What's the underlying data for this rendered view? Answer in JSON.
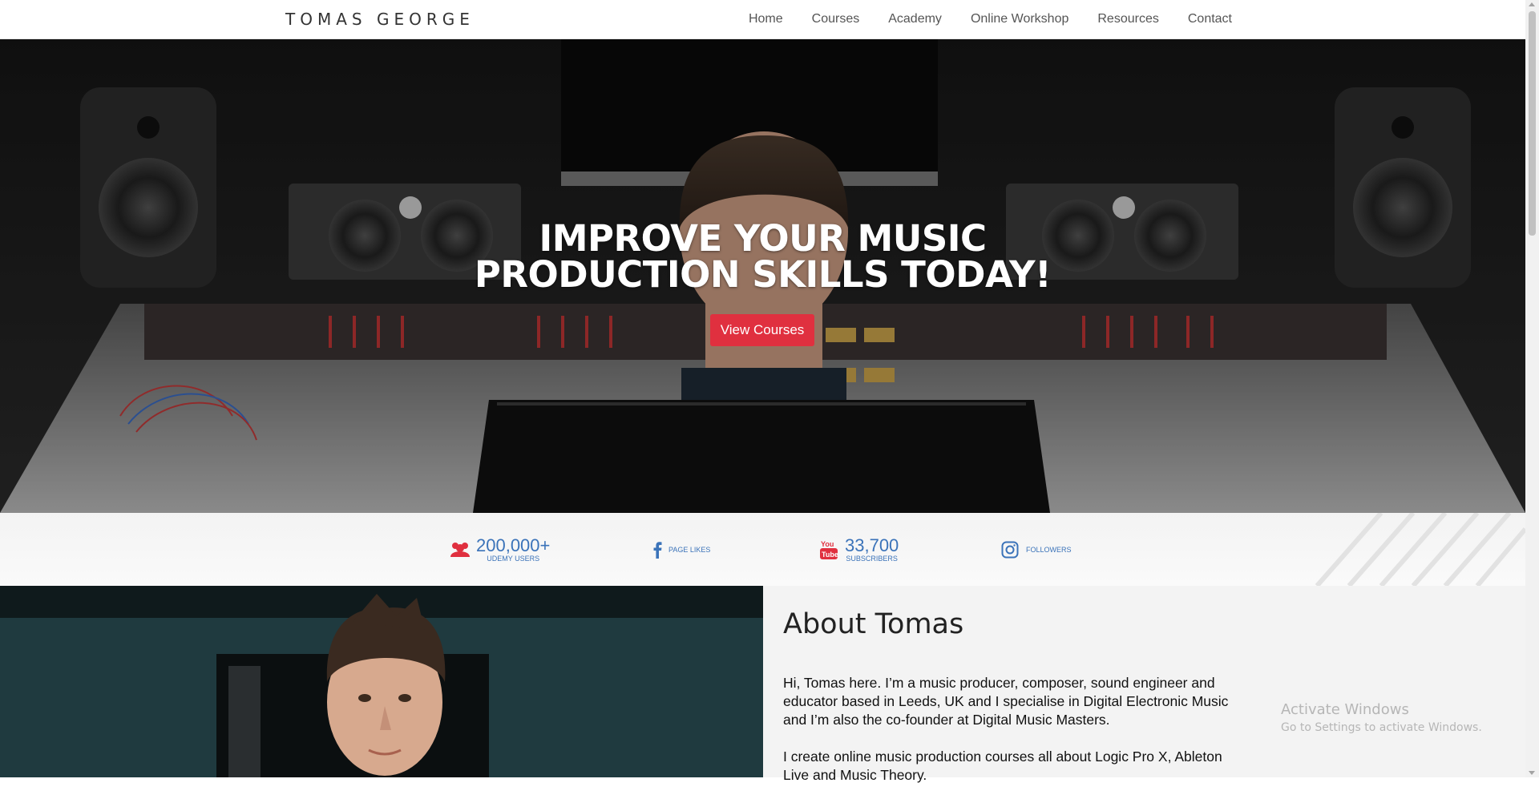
{
  "nav": {
    "brand": "TOMAS GEORGE",
    "items": [
      "Home",
      "Courses",
      "Academy",
      "Online Workshop",
      "Resources",
      "Contact"
    ]
  },
  "hero": {
    "title_line1": "IMPROVE YOUR MUSIC",
    "title_line2": "PRODUCTION SKILLS TODAY!",
    "button_label": "View Courses",
    "button_color": "#e0303f"
  },
  "stats": [
    {
      "icon": "users-icon",
      "value": "200,000+",
      "label": "UDEMY USERS",
      "icon_color": "#e0303f"
    },
    {
      "icon": "facebook-icon",
      "value": "",
      "label": "PAGE LIKES",
      "icon_color": "#3b73b9"
    },
    {
      "icon": "youtube-icon",
      "value": "33,700",
      "label": "SUBSCRIBERS",
      "icon_color": "#e0303f"
    },
    {
      "icon": "instagram-icon",
      "value": "",
      "label": "FOLLOWERS",
      "icon_color": "#3b73b9"
    }
  ],
  "about": {
    "title": "About Tomas",
    "paragraph1": "Hi, Tomas here. I’m a music producer, composer, sound engineer and educator based in Leeds, UK and I specialise in Digital Electronic Music and I’m also the co-founder at Digital Music Masters.",
    "paragraph2": "I create online music production courses all about Logic Pro X, Ableton Live and Music Theory."
  },
  "watermark": {
    "line1": "Activate Windows",
    "line2": "Go to Settings to activate Windows."
  },
  "accent_color": "#3b73b9"
}
